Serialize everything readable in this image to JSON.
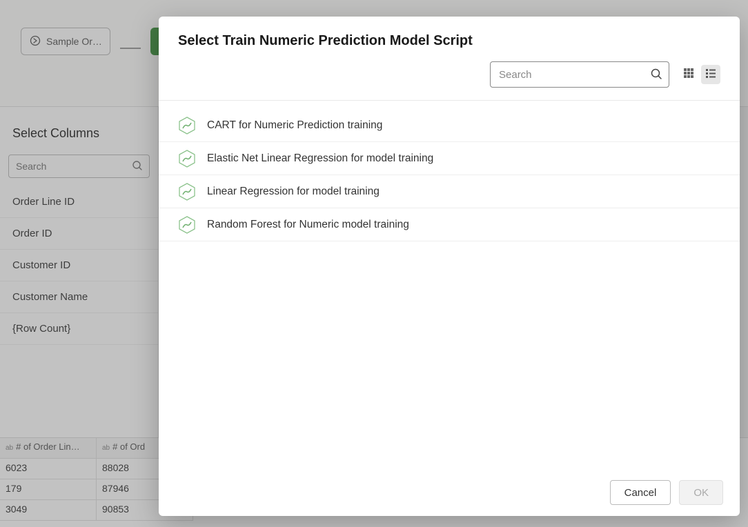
{
  "flow": {
    "node1_label": "Sample Or…"
  },
  "sidebar": {
    "title": "Select Columns",
    "search_placeholder": "Search",
    "columns": [
      "Order Line ID",
      "Order ID",
      "Customer ID",
      "Customer Name",
      "{Row Count}"
    ]
  },
  "table": {
    "col_type_badge": "ab",
    "headers": [
      "# of Order Lin…",
      "# of Ord"
    ],
    "rows": [
      [
        "6023",
        "88028"
      ],
      [
        "179",
        "87946"
      ],
      [
        "3049",
        "90853"
      ]
    ]
  },
  "modal": {
    "title": "Select Train Numeric Prediction Model Script",
    "search_placeholder": "Search",
    "scripts": [
      "CART for Numeric Prediction training",
      "Elastic Net Linear Regression for model training",
      "Linear Regression for model training",
      "Random Forest for Numeric model training"
    ],
    "buttons": {
      "cancel": "Cancel",
      "ok": "OK"
    }
  }
}
